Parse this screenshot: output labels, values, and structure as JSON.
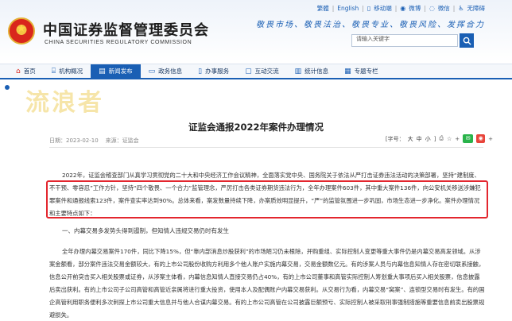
{
  "header": {
    "org_name_cn": "中国证券监督管理委员会",
    "org_name_en": "CHINA SECURITIES REGULATORY COMMISSION",
    "top_links": {
      "traditional": "繁體",
      "english": "English",
      "mobile": "移动端",
      "weibo": "微博",
      "wechat": "微信",
      "accessible": "无障碍"
    },
    "slogan": "敬畏市场、敬畏法治、敬畏专业、敬畏风险、发挥合力",
    "search": {
      "value": "请输入关键字"
    }
  },
  "nav": {
    "items": [
      {
        "label": "首页",
        "icon": "home-icon"
      },
      {
        "label": "机构概况",
        "icon": "building-icon"
      },
      {
        "label": "新闻发布",
        "icon": "newspaper-icon",
        "active": true
      },
      {
        "label": "政务信息",
        "icon": "monitor-icon"
      },
      {
        "label": "办事服务",
        "icon": "document-icon"
      },
      {
        "label": "互动交流",
        "icon": "chat-icon"
      },
      {
        "label": "统计信息",
        "icon": "chart-icon"
      },
      {
        "label": "专题专栏",
        "icon": "book-icon"
      }
    ]
  },
  "watermark": "流浪者",
  "article": {
    "title": "证监会通报2022年案件办理情况",
    "date": "日期：2023-02-10",
    "source": "来源：证监会",
    "font_size_label": "[字号：",
    "font_sizes": [
      "大",
      "中",
      "小"
    ],
    "font_size_end": "]",
    "p1": "2022年，证监会稽查部门从真学习贯彻党的二十大和中央经济工作会议精神，全面落实党中央、国务院关于依法从严打击证券违法活动的决策部署，坚持“建制度、不干预、零容忍”工作方针，坚持“四个敬畏、一个合力”监管理念，严厉打击各类证券期货违法行为，全年办理案件603件，其中重大案件136件，向公安机关移送涉嫌犯罪案件和通报线索123件，案件查实率达到90%。总体来看，案发数量持续下降，办案质效明显提升，“严”的监管氛围进一步巩固，市场生态进一步净化。案件办理情况和主要特点如下：",
    "heading1": "一、内幕交易多发势头得到遏制，但知情人违规交易仍时有发生",
    "p2": "全年办理内幕交易案件170件，同比下降15%，但“靠内部消息炒股获利”的市场陋习仍未根除，并购重组、实际控制人变更等重大事件仍是内幕交易高发领域。从涉案金额看，部分案件违法交易金额较大，有的上市公司股份收购方利用多个他人账户实施内幕交易，交易金额数亿元。有的涉案人员与内幕信息知情人存在密切联系接触，信息公开前突击买入相关股票或证券，从涉案主体看，内幕信息知情人直接交易仍占40%，有的上市公司董事和高管实际控制人筹划重大事项后买入相关股票，信息披露后卖出获利。有的上市公司子公司高管和高管近亲属将进行重大投资，使用本人及配偶账户内幕交易获利。从交易行为看，内幕交易“窝案”、连锁型交易时有发生。有的国企高管利用职务便利多次刺探上市公司重大信息并与他人合谋内幕交易。有的上市公司高管在公司披露巨额预亏、实际控制人被采取刑事强制措施等重要信息前卖出股票规避损失。"
  },
  "colors": {
    "brand_blue": "#1a5fb4",
    "highlight_red": "#e3262e"
  }
}
